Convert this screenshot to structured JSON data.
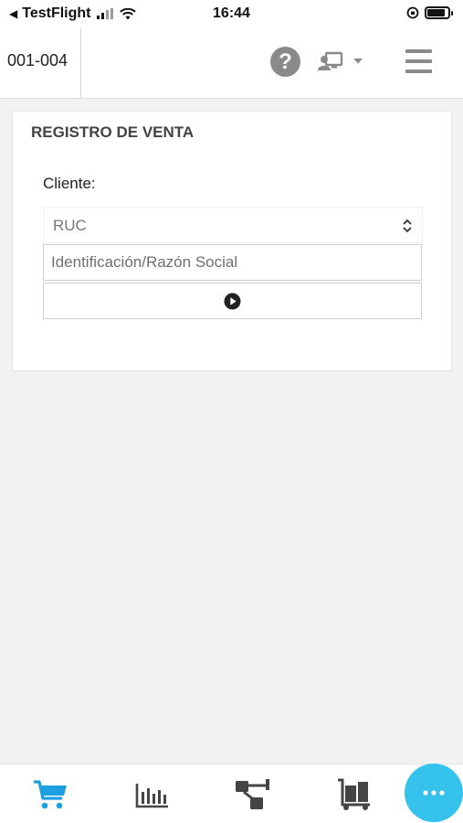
{
  "status_bar": {
    "back_app": "TestFlight",
    "time": "16:44"
  },
  "header": {
    "branch_code": "001-004",
    "help_icon": "question-circle-icon",
    "user_icon": "user-monitor-icon",
    "menu_icon": "hamburger-menu-icon"
  },
  "sale_form": {
    "title": "REGISTRO DE VENTA",
    "client_label": "Cliente:",
    "id_type_selected": "RUC",
    "id_input_placeholder": "Identificación/Razón Social",
    "submit_icon": "play-circle-icon"
  },
  "bottom_nav": {
    "items": [
      {
        "icon": "cart-icon",
        "active": true
      },
      {
        "icon": "bar-chart-icon",
        "active": false
      },
      {
        "icon": "hierarchy-icon",
        "active": false
      },
      {
        "icon": "inventory-cart-icon",
        "active": false
      }
    ],
    "fab_icon": "more-dots-icon"
  },
  "colors": {
    "accent": "#35c3ee",
    "active_nav": "#1e9fe0",
    "inactive_nav": "#444444",
    "icon_gray": "#8a8a8a",
    "background": "#f2f2f2"
  }
}
